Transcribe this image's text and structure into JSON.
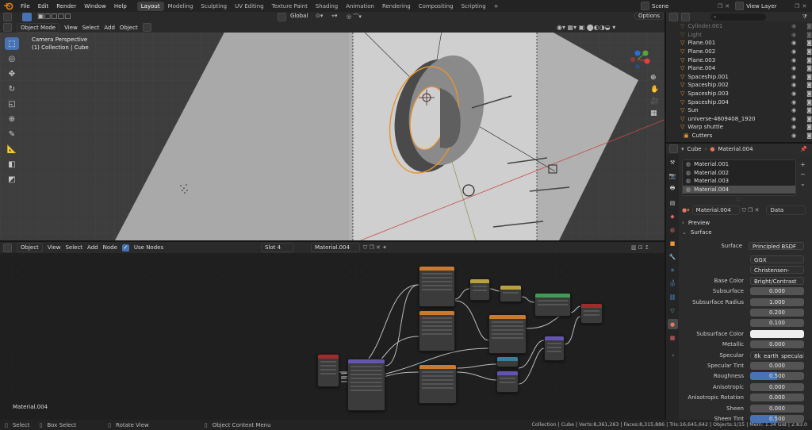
{
  "top_menu": [
    "File",
    "Edit",
    "Render",
    "Window",
    "Help"
  ],
  "workspaces": [
    {
      "label": "Layout",
      "active": true
    },
    {
      "label": "Modeling"
    },
    {
      "label": "Sculpting"
    },
    {
      "label": "UV Editing"
    },
    {
      "label": "Texture Paint"
    },
    {
      "label": "Shading"
    },
    {
      "label": "Animation"
    },
    {
      "label": "Rendering"
    },
    {
      "label": "Compositing"
    },
    {
      "label": "Scripting"
    },
    {
      "label": "+"
    }
  ],
  "scene": "Scene",
  "view_layer": "View Layer",
  "viewport": {
    "mode": "Object Mode",
    "menus": [
      "View",
      "Select",
      "Add",
      "Object"
    ],
    "orientation": "Global",
    "options": "Options",
    "overlay_line1": "Camera Perspective",
    "overlay_line2": "(1) Collection | Cube"
  },
  "node_editor": {
    "type": "Object",
    "menus": [
      "View",
      "Select",
      "Add",
      "Node"
    ],
    "use_nodes": "Use Nodes",
    "slot": "Slot 4",
    "material": "Material.004",
    "corner_label": "Material.004"
  },
  "outliner": {
    "items": [
      {
        "name": "Cylinder.001",
        "faded": true
      },
      {
        "name": "Light",
        "faded": true
      },
      {
        "name": "Plane.001"
      },
      {
        "name": "Plane.002"
      },
      {
        "name": "Plane.003"
      },
      {
        "name": "Plane.004"
      },
      {
        "name": "Spaceship.001"
      },
      {
        "name": "Spaceship.002"
      },
      {
        "name": "Spaceship.003"
      },
      {
        "name": "Spaceship.004"
      },
      {
        "name": "Sun"
      },
      {
        "name": "universe-4609408_1920"
      },
      {
        "name": "Warp shuttle"
      },
      {
        "name": "Cutters"
      }
    ]
  },
  "properties": {
    "breadcrumb_object": "Cube",
    "breadcrumb_material": "Material.004",
    "slots": [
      "Material.001",
      "Material.002",
      "Material.003",
      "Material.004"
    ],
    "active_slot": 3,
    "material_name": "Material.004",
    "link": "Data",
    "panel_preview": "Preview",
    "panel_surface": "Surface",
    "surface_label": "Surface",
    "surface_value": "Principled BSDF",
    "distribution": "GGX",
    "subsurface_method": "Christensen-Burley",
    "rows": [
      {
        "label": "Base Color",
        "value": "Bright/Contrast",
        "style": "dd",
        "arrow": true
      },
      {
        "label": "Subsurface",
        "value": "0.000"
      },
      {
        "label": "Subsurface Radius",
        "value": "1.000"
      },
      {
        "label": "",
        "value": "0.200"
      },
      {
        "label": "",
        "value": "0.100"
      },
      {
        "label": "Subsurface Color",
        "value": "",
        "style": "white"
      },
      {
        "label": "Metallic",
        "value": "0.000"
      },
      {
        "label": "Specular",
        "value": "8k_earth_specular_ma...",
        "style": "dd",
        "arrow": true
      },
      {
        "label": "Specular Tint",
        "value": "0.000"
      },
      {
        "label": "Roughness",
        "value": "0.500",
        "style": "blue",
        "fill": 0.5
      },
      {
        "label": "Anisotropic",
        "value": "0.000"
      },
      {
        "label": "Anisotropic Rotation",
        "value": "0.000"
      },
      {
        "label": "Sheen",
        "value": "0.000"
      },
      {
        "label": "Sheen Tint",
        "value": "0.500",
        "style": "blue",
        "fill": 0.5
      }
    ]
  },
  "status": {
    "select": "Select",
    "box_select": "Box Select",
    "rotate": "Rotate View",
    "context": "Object Context Menu",
    "stats": "Collection | Cube | Verts:8,361,263 | Faces:8,315,886 | Tris:16,645,642 | Objects:1/15 | Mem: 1.34 GiB | 2.83.0"
  },
  "colors": {
    "accent": "#4772b3",
    "selection": "#e89a3c",
    "node_texture": "#c87a30",
    "node_shader": "#3f9b56",
    "node_vector": "#6454b0",
    "node_output": "#a02b2b",
    "node_converter": "#3a7f99",
    "node_color": "#b8a23c"
  }
}
